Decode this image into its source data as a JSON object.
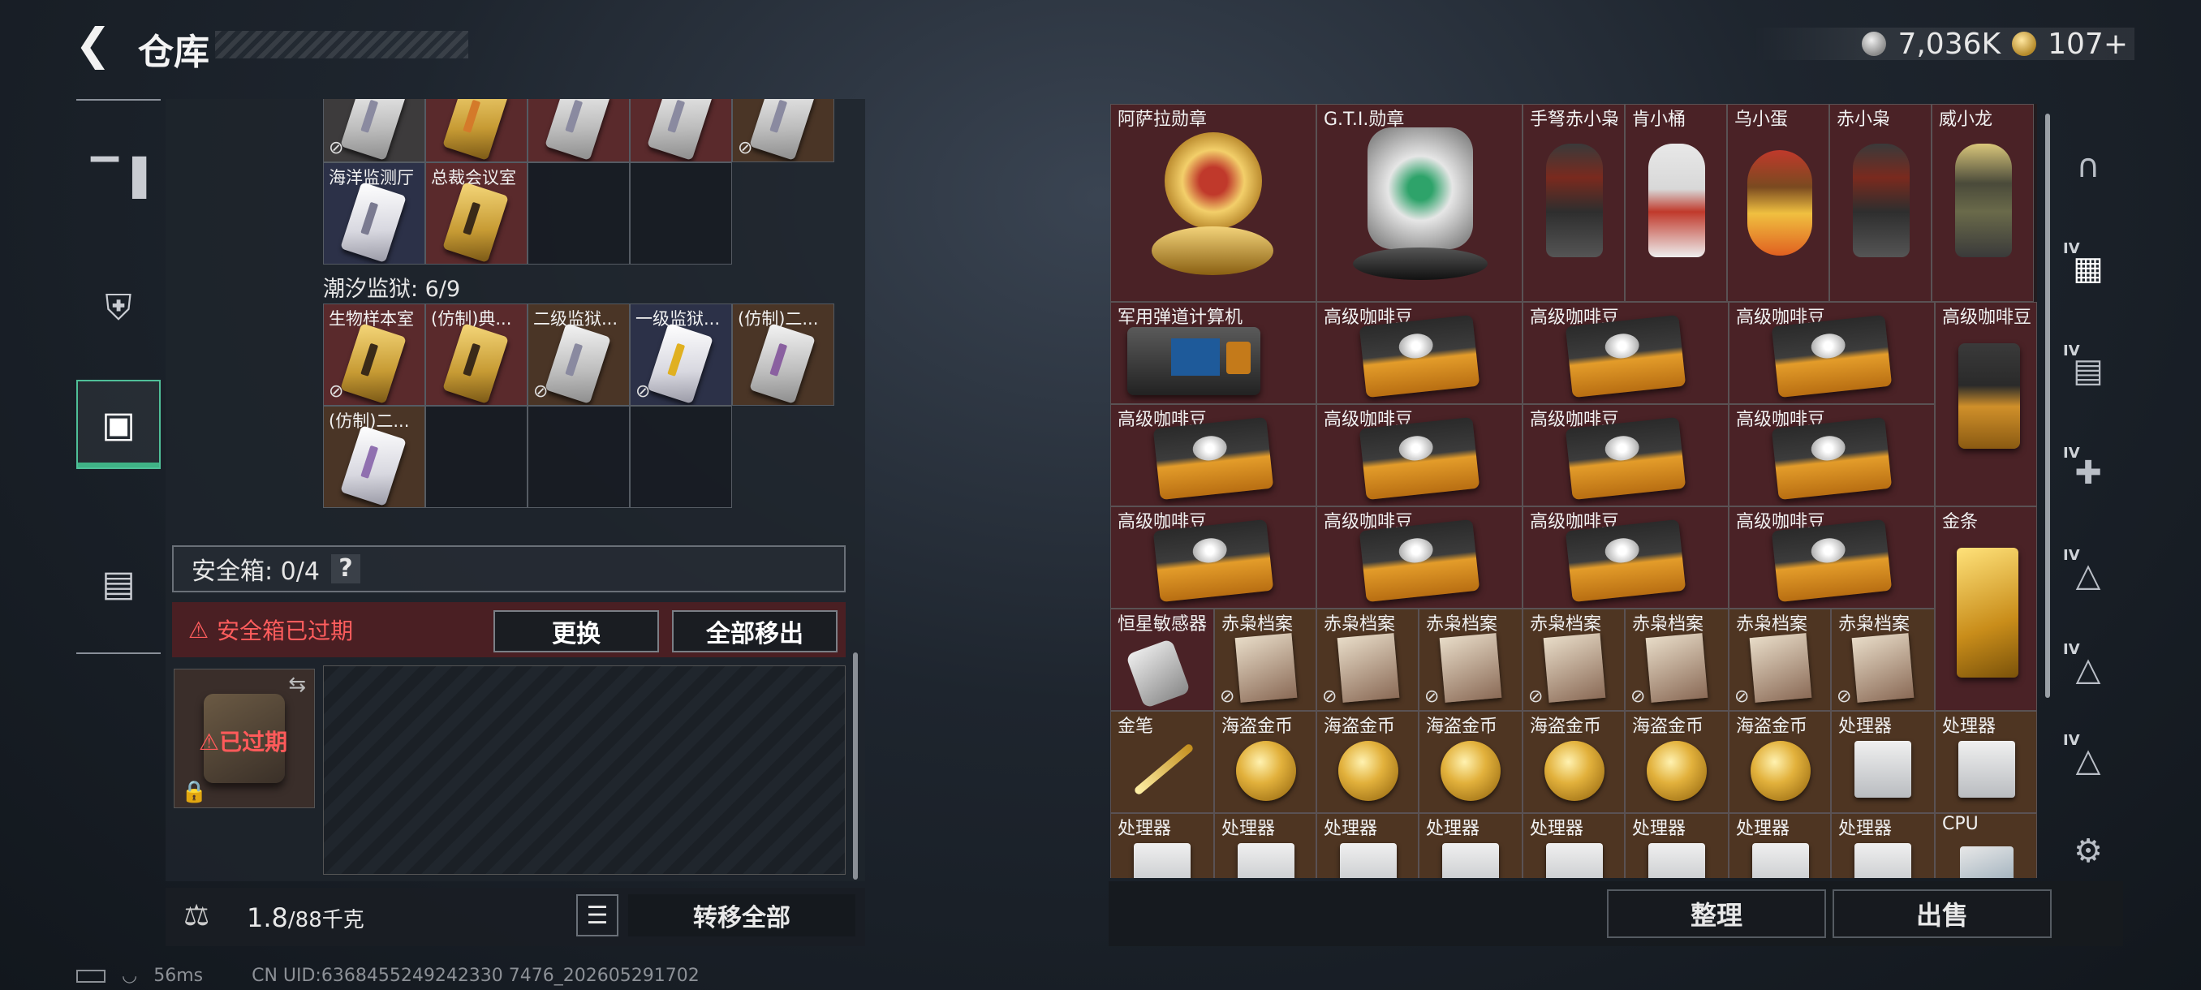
{
  "header": {
    "back_icon": "chevron-left-icon",
    "title": "仓库"
  },
  "currency": {
    "silver_icon": "silver-coin-icon",
    "silver_amount": "7,036K",
    "gold_icon": "gold-coin-icon",
    "gold_amount": "107+"
  },
  "left_nav": [
    {
      "icon": "gun-icon",
      "active": false
    },
    {
      "icon": "armor-icon",
      "active": false
    },
    {
      "icon": "backpack-icon",
      "active": true
    },
    {
      "icon": "toolbox-icon",
      "active": false
    }
  ],
  "storage": {
    "group1_row_top": [
      {
        "label": "",
        "color": "gray",
        "card": "silver",
        "no_use": true
      },
      {
        "label": "",
        "color": "red",
        "card": "gold",
        "no_use": false
      },
      {
        "label": "",
        "color": "red",
        "card": "silver",
        "no_use": false
      },
      {
        "label": "",
        "color": "red",
        "card": "silver",
        "no_use": false
      },
      {
        "label": "",
        "color": "orange",
        "card": "silver",
        "no_use": true
      }
    ],
    "group1_row2": [
      {
        "label": "海洋监测厅",
        "color": "blue",
        "card": "white"
      },
      {
        "label": "总裁会议室",
        "color": "red",
        "card": "gold"
      }
    ],
    "section_title": "潮汐监狱: 6/9",
    "group2_row1": [
      {
        "label": "生物样本室",
        "color": "red",
        "card": "gold",
        "no_use": true
      },
      {
        "label": "(仿制)典...",
        "color": "red",
        "card": "gold",
        "no_use": false
      },
      {
        "label": "二级监狱...",
        "color": "orange",
        "card": "silver",
        "no_use": true
      },
      {
        "label": "一级监狱...",
        "color": "blue",
        "card": "white",
        "no_use": true
      },
      {
        "label": "(仿制)二...",
        "color": "orange",
        "card": "silver",
        "no_use": false
      }
    ],
    "group2_row2": [
      {
        "label": "(仿制)二...",
        "color": "orange",
        "card": "white",
        "no_use": false
      }
    ]
  },
  "safebox": {
    "label": "安全箱: 0/4",
    "help": "?",
    "expired_warning": "安全箱已过期",
    "replace_button": "更换",
    "move_all_button": "全部移出",
    "item_status": "已过期"
  },
  "left_bottom": {
    "weight_current": "1.8",
    "weight_max": "/88千克",
    "transfer_all": "转移全部"
  },
  "right_items": {
    "row1": [
      {
        "label": "阿萨拉勋章"
      },
      {
        "label": "G.T.I.勋章"
      },
      {
        "label": "手弩赤小枭"
      },
      {
        "label": "肯小桶"
      },
      {
        "label": "乌小蛋"
      },
      {
        "label": "赤小枭"
      },
      {
        "label": "威小龙"
      }
    ],
    "row2": [
      {
        "label": "军用弹道计算机"
      },
      {
        "label": "高级咖啡豆"
      },
      {
        "label": "高级咖啡豆"
      },
      {
        "label": "高级咖啡豆"
      },
      {
        "label": "高级咖啡豆"
      }
    ],
    "row3": [
      {
        "label": "高级咖啡豆"
      },
      {
        "label": "高级咖啡豆"
      },
      {
        "label": "高级咖啡豆"
      },
      {
        "label": "高级咖啡豆"
      }
    ],
    "row4": [
      {
        "label": "高级咖啡豆"
      },
      {
        "label": "高级咖啡豆"
      },
      {
        "label": "高级咖啡豆"
      },
      {
        "label": "高级咖啡豆"
      },
      {
        "label": "金条"
      }
    ],
    "row5": [
      {
        "label": "恒星敏感器"
      },
      {
        "label": "赤枭档案"
      },
      {
        "label": "赤枭档案"
      },
      {
        "label": "赤枭档案"
      },
      {
        "label": "赤枭档案"
      },
      {
        "label": "赤枭档案"
      },
      {
        "label": "赤枭档案"
      },
      {
        "label": "赤枭档案"
      }
    ],
    "row6": [
      {
        "label": "金笔"
      },
      {
        "label": "海盗金币"
      },
      {
        "label": "海盗金币"
      },
      {
        "label": "海盗金币"
      },
      {
        "label": "海盗金币"
      },
      {
        "label": "海盗金币"
      },
      {
        "label": "海盗金币"
      },
      {
        "label": "处理器"
      },
      {
        "label": "处理器"
      }
    ],
    "row7": [
      {
        "label": "处理器"
      },
      {
        "label": "处理器"
      },
      {
        "label": "处理器"
      },
      {
        "label": "处理器"
      },
      {
        "label": "处理器"
      },
      {
        "label": "处理器"
      },
      {
        "label": "处理器"
      },
      {
        "label": "处理器"
      },
      {
        "label": "CPU"
      }
    ]
  },
  "right_bottom": {
    "organize": "整理",
    "sell": "出售"
  },
  "right_nav": [
    {
      "icon": "helmet-icon",
      "tier": ""
    },
    {
      "icon": "case-iv-icon",
      "tier": "IV"
    },
    {
      "icon": "folder-iv-icon",
      "tier": "IV"
    },
    {
      "icon": "medkit-iv-icon",
      "tier": "IV"
    },
    {
      "icon": "warning-iv-icon",
      "tier": "IV"
    },
    {
      "icon": "warning-iv-icon",
      "tier": "IV"
    },
    {
      "icon": "warning-iv-icon",
      "tier": "IV"
    },
    {
      "icon": "gear-icon",
      "tier": ""
    }
  ],
  "status_bar": {
    "ping": "56ms",
    "uid": "CN UID:6368455249242330 7476_202605291702"
  }
}
